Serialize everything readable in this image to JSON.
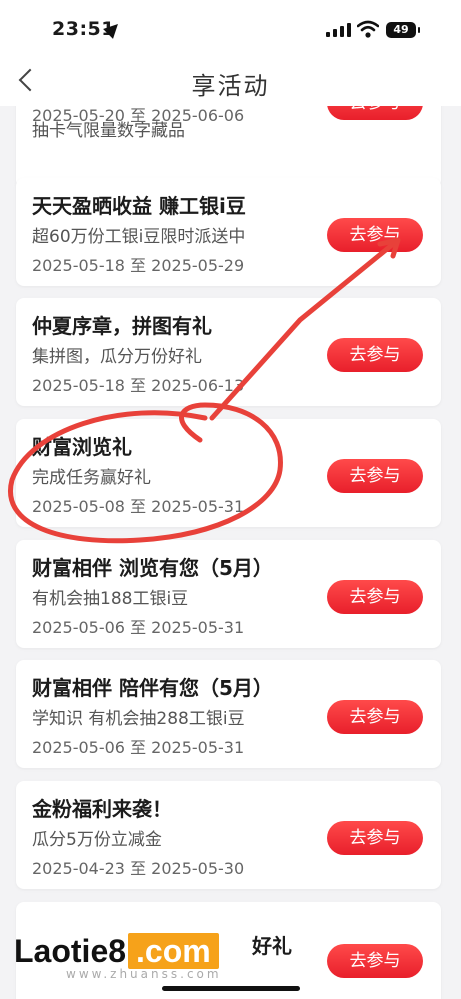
{
  "status_bar": {
    "time": "23:51",
    "battery": "49"
  },
  "nav": {
    "title": "享活动"
  },
  "join_label": "去参与",
  "activities": [
    {
      "title": "",
      "subtitle": "抽卡气限量数字藏品",
      "date": "2025-05-20 至 2025-06-06"
    },
    {
      "title": "天天盈晒收益 赚工银i豆",
      "subtitle": "超60万份工银i豆限时派送中",
      "date": "2025-05-18 至 2025-05-29"
    },
    {
      "title": "仲夏序章，拼图有礼",
      "subtitle": "集拼图，瓜分万份好礼",
      "date": "2025-05-18 至 2025-06-13"
    },
    {
      "title": "财富浏览礼",
      "subtitle": "完成任务赢好礼",
      "date": "2025-05-08 至 2025-05-31"
    },
    {
      "title": "财富相伴 浏览有您（5月）",
      "subtitle": "有机会抽188工银i豆",
      "date": "2025-05-06 至 2025-05-31"
    },
    {
      "title": "财富相伴 陪伴有您（5月）",
      "subtitle": "学知识 有机会抽288工银i豆",
      "date": "2025-05-06 至 2025-05-31"
    },
    {
      "title": "金粉福利来袭！",
      "subtitle": "瓜分5万份立减金",
      "date": "2025-04-23 至 2025-05-30"
    },
    {
      "title": "好礼",
      "subtitle": "",
      "date": ""
    }
  ],
  "watermark": {
    "brand": "Laotie8",
    "brand_suffix": ".com",
    "url": "www.zhuanss.com"
  },
  "colors": {
    "accent": "#e81f2b",
    "annotation": "#e8413a"
  }
}
